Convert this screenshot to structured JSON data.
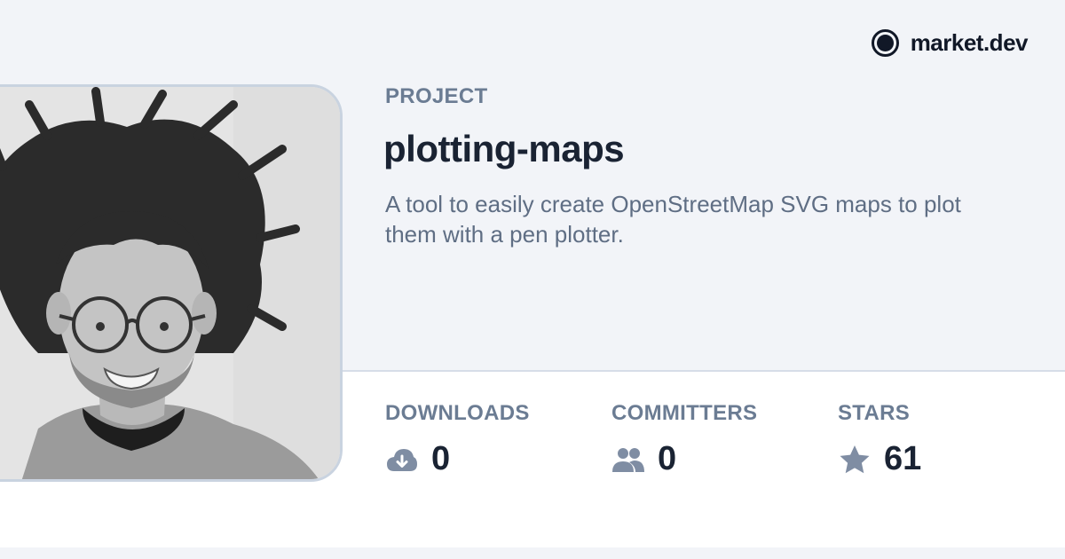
{
  "brand": {
    "name": "market.dev",
    "icon": "circle-logo-icon"
  },
  "project": {
    "section_label": "PROJECT",
    "title": "plotting-maps",
    "description": "A tool to easily create OpenStreetMap SVG maps to plot them with a pen plotter."
  },
  "stats": [
    {
      "label": "DOWNLOADS",
      "value": "0",
      "icon": "cloud-download-icon"
    },
    {
      "label": "COMMITTERS",
      "value": "0",
      "icon": "users-icon"
    },
    {
      "label": "STARS",
      "value": "61",
      "icon": "star-icon"
    }
  ],
  "colors": {
    "background": "#f2f4f8",
    "panel": "#ffffff",
    "label": "#6b7c93",
    "title": "#1a2333",
    "description": "#5f6e84",
    "icon": "#7f8da3"
  }
}
